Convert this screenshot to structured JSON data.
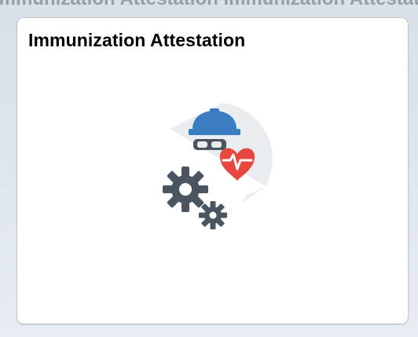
{
  "background_strip": {
    "text": "Immunization Attestation Immunization Attestation Immunization Attestation"
  },
  "tile": {
    "title": "Immunization Attestation",
    "icon": "immunization-attestation-icon",
    "colors": {
      "backdrop": "#e9edf0",
      "helmet": "#3a7dc0",
      "goggles": "#4a5560",
      "heart": "#e8473f",
      "gear": "#4a5560"
    }
  }
}
